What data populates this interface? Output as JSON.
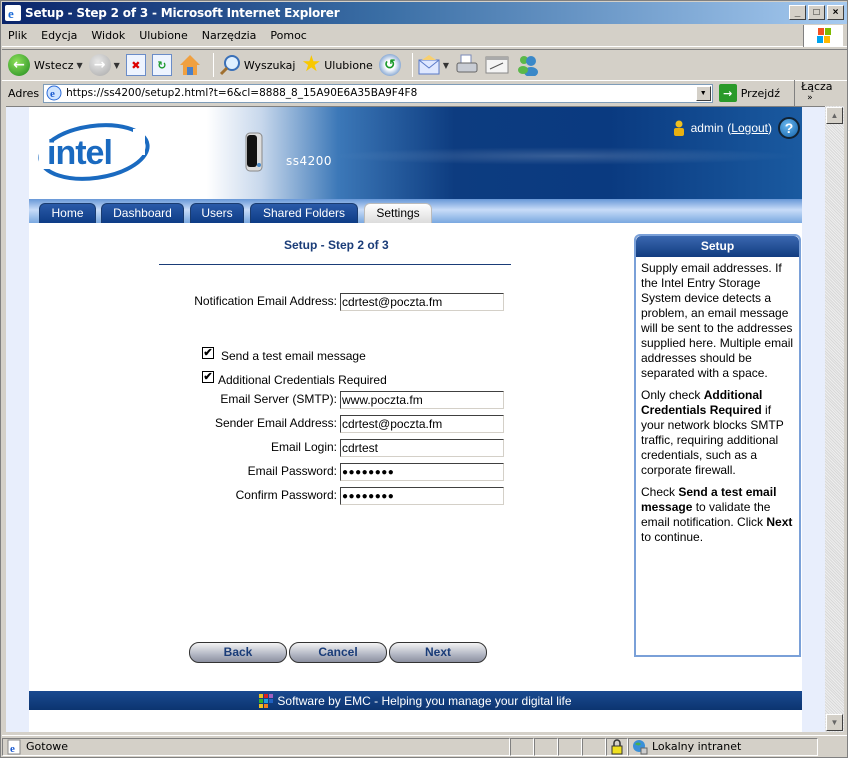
{
  "window": {
    "title": "Setup - Step 2 of 3 - Microsoft Internet Explorer",
    "controls": {
      "minimize": "_",
      "maximize": "□",
      "close": "×"
    }
  },
  "menubar": {
    "items": [
      {
        "label": "Plik",
        "accel": "P"
      },
      {
        "label": "Edycja",
        "accel": "E"
      },
      {
        "label": "Widok",
        "accel": "W"
      },
      {
        "label": "Ulubione",
        "accel": "U"
      },
      {
        "label": "Narzędzia",
        "accel": "N"
      },
      {
        "label": "Pomoc",
        "accel": "c"
      }
    ]
  },
  "toolbar": {
    "back_label": "Wstecz",
    "search_label": "Wyszukaj",
    "favorites_label": "Ulubione"
  },
  "addressbar": {
    "label": "Adres",
    "url": "https://ss4200/setup2.html?t=6&cl=8888_8_15A90E6A35BA9F4F8",
    "go_label": "Przejdź",
    "links_label": "Łącza",
    "links_more": "»"
  },
  "header": {
    "brand": "intel",
    "model": "ss4200",
    "user": "admin",
    "logout_label": "Logout",
    "help": "?"
  },
  "tabs": [
    {
      "label": "Home",
      "active": false
    },
    {
      "label": "Dashboard",
      "active": false
    },
    {
      "label": "Users",
      "active": false
    },
    {
      "label": "Shared Folders",
      "active": false
    },
    {
      "label": "Settings",
      "active": true
    }
  ],
  "form": {
    "title": "Setup - Step 2 of 3",
    "notification_email": {
      "label": "Notification Email Address:",
      "value": "cdrtest@poczta.fm"
    },
    "send_test": {
      "label": "Send a test email message",
      "checked": true,
      "mark": "✔"
    },
    "additional_credentials": {
      "label": "Additional Credentials Required",
      "checked": true,
      "mark": "✔"
    },
    "smtp_server": {
      "label": "Email Server (SMTP):",
      "value": "www.poczta.fm"
    },
    "sender_email": {
      "label": "Sender Email Address:",
      "value": "cdrtest@poczta.fm"
    },
    "login": {
      "label": "Email Login:",
      "value": "cdrtest"
    },
    "password": {
      "label": "Email Password:",
      "value": "●●●●●●●●"
    },
    "confirm_password": {
      "label": "Confirm Password:",
      "value": "●●●●●●●●"
    },
    "buttons": {
      "back": "Back",
      "cancel": "Cancel",
      "next": "Next"
    }
  },
  "sidebar": {
    "title": "Setup",
    "p1": "Supply email addresses. If the Intel Entry Storage System device detects a problem, an email message will be sent to the addresses supplied here. Multiple email addresses should be separated with a space.",
    "p2_pre": "Only check ",
    "p2_bold": "Additional Credentials Required",
    "p2_post": " if your network blocks SMTP traffic, requiring additional credentials, such as a corporate firewall.",
    "p3_pre": "Check ",
    "p3_bold": "Send a test email message",
    "p3_mid": " to validate the email notification. Click ",
    "p3_bold2": "Next",
    "p3_post": " to continue."
  },
  "footer": {
    "text": "Software by EMC - Helping you manage your digital life"
  },
  "statusbar": {
    "status": "Gotowe",
    "zone": "Lokalny intranet"
  },
  "colors": {
    "accent": "#1a3c78",
    "tab_blue": "#0d3c86",
    "footer": "#0c3470"
  }
}
